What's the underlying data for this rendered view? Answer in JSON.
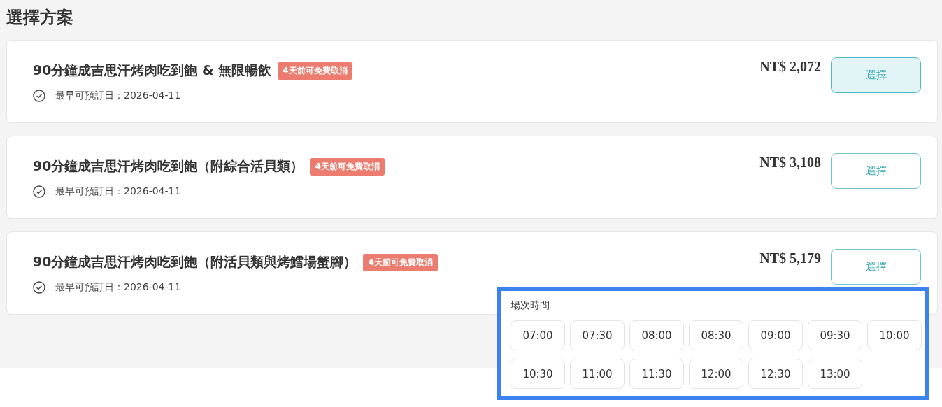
{
  "title": "選擇方案",
  "plans": [
    {
      "name": "90分鐘成吉思汗烤肉吃到飽 & 無限暢飲",
      "badge": "4天前可免費取消",
      "earliest": "最早可預訂日：2026-04-11",
      "price": "NT$ 2,072",
      "button": "選擇",
      "selected": true
    },
    {
      "name": "90分鐘成吉思汗烤肉吃到飽（附綜合活貝類）",
      "badge": "4天前可免費取消",
      "earliest": "最早可預訂日：2026-04-11",
      "price": "NT$ 3,108",
      "button": "選擇",
      "selected": false
    },
    {
      "name": "90分鐘成吉思汗烤肉吃到飽（附活貝類與烤鱈場蟹腳）",
      "badge": "4天前可免費取消",
      "earliest": "最早可預訂日：2026-04-11",
      "price": "NT$ 5,179",
      "button": "選擇",
      "selected": false
    }
  ],
  "time_picker": {
    "label": "場次時間",
    "times": [
      "07:00",
      "07:30",
      "08:00",
      "08:30",
      "09:00",
      "09:30",
      "10:00",
      "10:30",
      "11:00",
      "11:30",
      "12:00",
      "12:30",
      "13:00"
    ]
  }
}
